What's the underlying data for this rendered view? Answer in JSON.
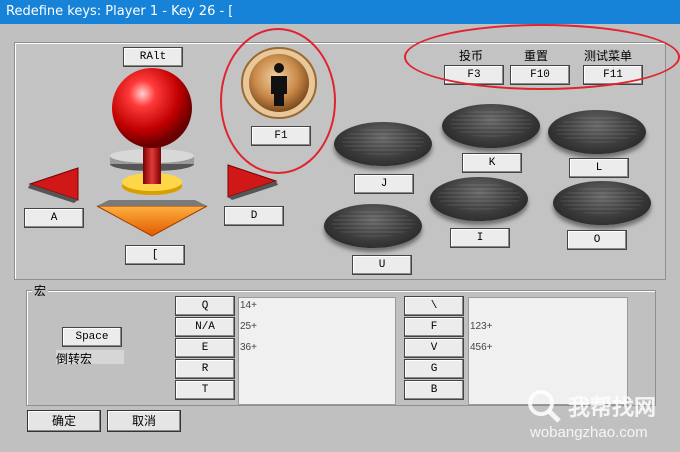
{
  "window": {
    "title": "Redefine keys: Player 1 - Key 26 - ["
  },
  "joystick": {
    "up_key": "RAlt",
    "left_key": "A",
    "right_key": "D",
    "down_key": "["
  },
  "coin_button": {
    "key": "F1"
  },
  "top_right": {
    "labels": [
      "投币",
      "重置",
      "测试菜单"
    ],
    "keys": [
      "F3",
      "F10",
      "F11"
    ]
  },
  "buttons": {
    "row1": [
      "J",
      "K",
      "L"
    ],
    "row2": [
      "U",
      "I",
      "O"
    ]
  },
  "macro": {
    "group_label": "宏",
    "space_key": "Space",
    "reverse_label": "倒转宏",
    "left_keys": [
      "Q",
      "N/A",
      "E",
      "R",
      "T"
    ],
    "left_macros": [
      "14+",
      "25+",
      "36+"
    ],
    "right_keys": [
      "\\",
      "F",
      "V",
      "G",
      "B"
    ],
    "right_macros": [
      "123+",
      "456+"
    ]
  },
  "dialog": {
    "ok_label": "确定",
    "cancel_label": "取消"
  },
  "watermark": {
    "text": "我帮找网",
    "url": "wobangzhao.com"
  },
  "colors": {
    "titlebar": "#1683d8",
    "annotation": "#e0232e",
    "ball": "#d81818"
  }
}
